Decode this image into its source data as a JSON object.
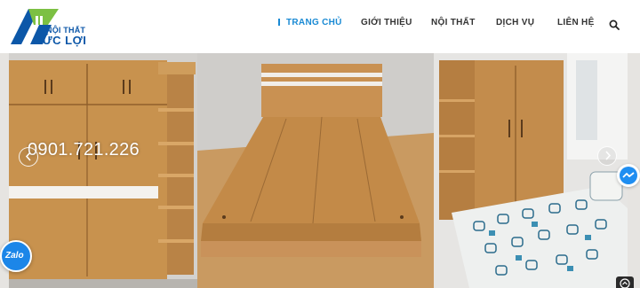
{
  "logo": {
    "line1": "NỘI THẤT",
    "line2": "ĐỨC LỢI"
  },
  "nav": {
    "home": "TRANG CHỦ",
    "about": "GIỚI THIỆU",
    "furniture": "NỘI THẤT",
    "services": "DỊCH VỤ",
    "contact": "LIÊN HỆ"
  },
  "slider": {
    "phone": "0901.721.226"
  },
  "widgets": {
    "zalo": "Zalo"
  },
  "icons": {
    "search": "search-icon",
    "prev": "chevron-left-icon",
    "next": "chevron-right-icon",
    "messenger": "messenger-icon",
    "zalo": "zalo-icon",
    "scroll_top": "arrow-up-icon"
  },
  "colors": {
    "brand_blue": "#0c57a8",
    "brand_green": "#7cc043",
    "nav_active": "#1a8ad4",
    "nav_text": "#333333"
  }
}
